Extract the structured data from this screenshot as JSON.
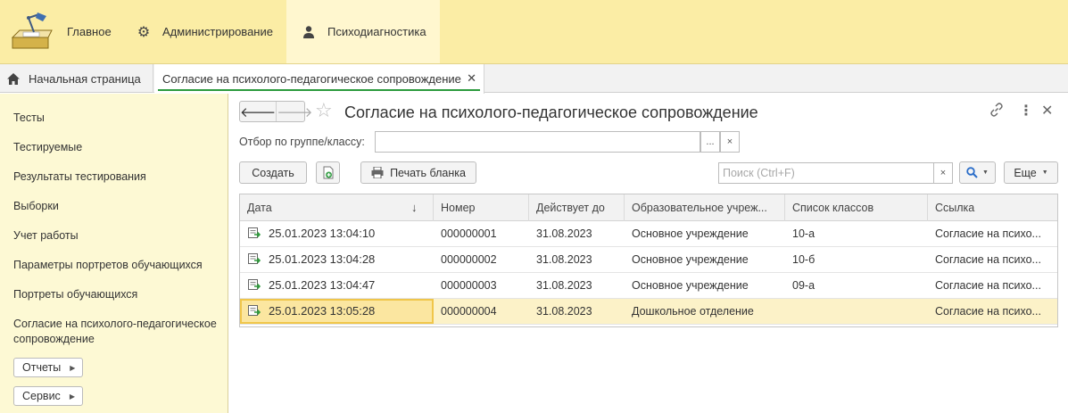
{
  "sections": {
    "main": "Главное",
    "admin": "Администрирование",
    "psy": "Психодиагностика"
  },
  "tabs": {
    "home": "Начальная страница",
    "document": "Согласие на психолого-педагогическое сопровождение",
    "close_glyph": "✕"
  },
  "sidebar": {
    "items": [
      "Тесты",
      "Тестируемые",
      "Результаты тестирования",
      "Выборки",
      "Учет работы",
      "Параметры портретов обучающихся",
      "Портреты обучающихся",
      "Согласие на психолого-педагогическое сопровождение"
    ],
    "reports": "Отчеты",
    "service": "Сервис"
  },
  "form": {
    "title": "Согласие на психолого-педагогическое сопровождение",
    "filter_label": "Отбор по группе/классу:",
    "filter_value": "",
    "create": "Создать",
    "print": "Печать бланка",
    "search_placeholder": "Поиск (Ctrl+F)",
    "more": "Еще",
    "choose_glyph": "...",
    "clear_glyph": "×"
  },
  "table": {
    "columns": [
      "Дата",
      "Номер",
      "Действует до",
      "Образовательное учреж...",
      "Список классов",
      "Ссылка"
    ],
    "sorted_column": "Дата",
    "sort_direction": "descending",
    "selected_row": 3,
    "rows": [
      [
        "25.01.2023 13:04:10",
        "000000001",
        "31.08.2023",
        "Основное учреждение",
        "10-а",
        "Согласие на психо..."
      ],
      [
        "25.01.2023 13:04:28",
        "000000002",
        "31.08.2023",
        "Основное учреждение",
        "10-б",
        "Согласие на психо..."
      ],
      [
        "25.01.2023 13:04:47",
        "000000003",
        "31.08.2023",
        "Основное учреждение",
        "09-а",
        "Согласие на психо..."
      ],
      [
        "25.01.2023 13:05:28",
        "000000004",
        "31.08.2023",
        "Дошкольное отделение",
        "",
        "Согласие на психо..."
      ]
    ]
  },
  "colors": {
    "topbar": "#fbeda5",
    "sidebar": "#fdf9d4",
    "active_tab_underline": "#2b9a3d",
    "selected_row": "#fcf2c8",
    "search_accent": "#2c6ec9"
  },
  "icons": {
    "logo": "desk-lamp-logo-icon",
    "admin": "gear-icon",
    "psy": "person-icon",
    "home": "home-icon",
    "row": "document-posted-icon",
    "link": "link-icon",
    "more": "more-vertical-icon",
    "close": "close-icon",
    "star": "favorite-star-icon",
    "print": "printer-icon",
    "search": "search-icon"
  }
}
